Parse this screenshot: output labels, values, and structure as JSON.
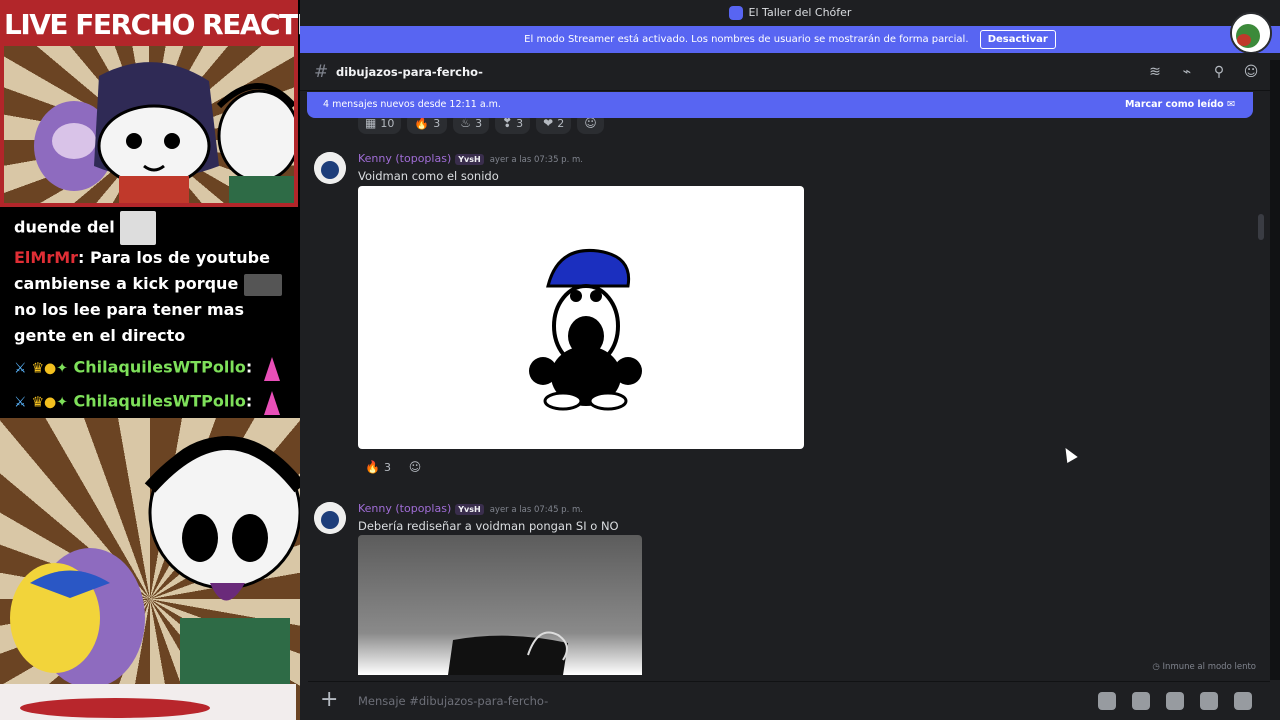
{
  "overlay": {
    "banner": "LIVE FERCHO REACTION",
    "chat": {
      "line1": {
        "text": "duende del"
      },
      "line2": {
        "user": "ElMrMr",
        "text_a": ": Para los de youtube cambiense a kick porque",
        "text_b": "no los lee para tener mas gente en el directo"
      },
      "line3": {
        "user": "ChilaquilesWTPollo",
        "sep": ":"
      },
      "line4": {
        "user": "ChilaquilesWTPollo",
        "sep": ":"
      }
    }
  },
  "app": {
    "window_title": "El Taller del Chófer",
    "streamer_notice": "El modo Streamer está activado. Los nombres de usuario se mostrarán de forma parcial.",
    "deactivate_label": "Desactivar",
    "channel_name": "dibujazos-para-fercho-",
    "new_messages": "4 mensajes nuevos desde 12:11 a.m.",
    "mark_read": "Marcar como leído",
    "top_reactions": [
      "10",
      "3",
      "3",
      "3",
      "2"
    ],
    "messages": [
      {
        "author": "Kenny (topoplas)",
        "tag": "YvsH",
        "time": "ayer a las 07:35 p. m.",
        "text": "Voidman como el sonido",
        "reaction_count": "3"
      },
      {
        "author": "Kenny (topoplas)",
        "tag": "YvsH",
        "time": "ayer a las 07:45 p. m.",
        "text": "Debería rediseñar a voidman pongan SI o NO"
      }
    ],
    "slowmode": "Inmune al modo lento",
    "input_placeholder": "Mensaje #dibujazos-para-fercho-"
  }
}
